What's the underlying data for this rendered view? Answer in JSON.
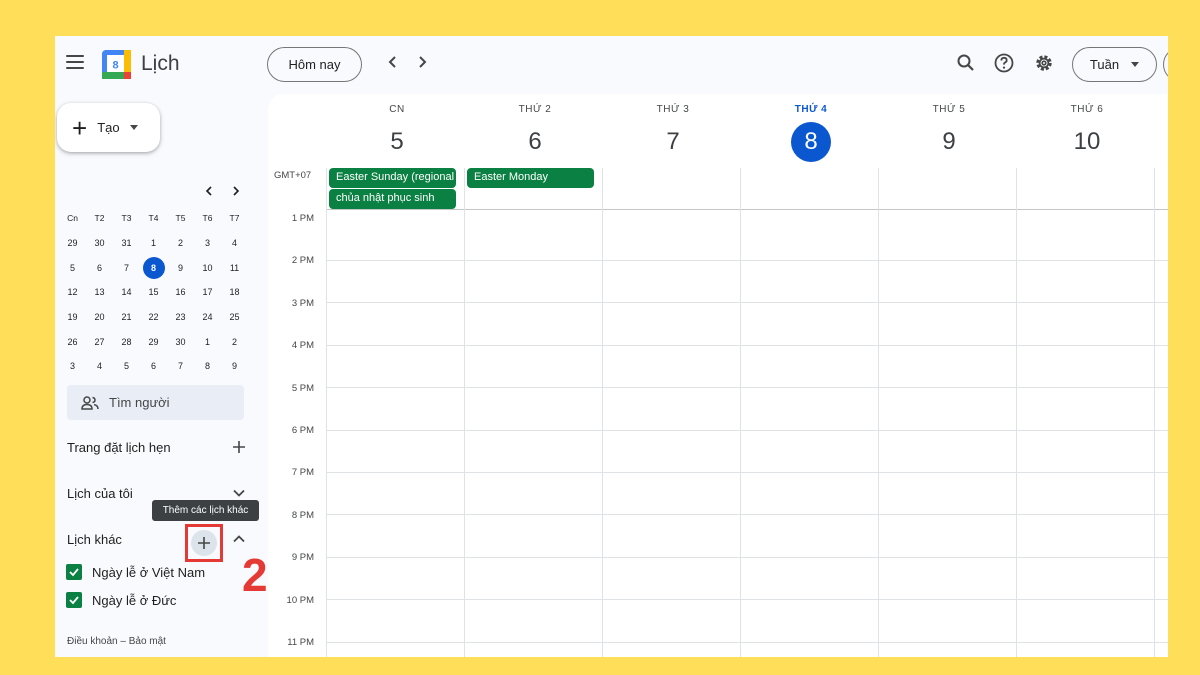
{
  "header": {
    "app_title": "Lịch",
    "logo_number": "8",
    "today_label": "Hôm nay",
    "view_label": "Tuần"
  },
  "sidebar": {
    "create_label": "Tạo",
    "mini_calendar": {
      "weekdays": [
        "Cn",
        "T2",
        "T3",
        "T4",
        "T5",
        "T6",
        "T7"
      ],
      "weeks": [
        [
          "29",
          "30",
          "31",
          "1",
          "2",
          "3",
          "4"
        ],
        [
          "5",
          "6",
          "7",
          "8",
          "9",
          "10",
          "11"
        ],
        [
          "12",
          "13",
          "14",
          "15",
          "16",
          "17",
          "18"
        ],
        [
          "19",
          "20",
          "21",
          "22",
          "23",
          "24",
          "25"
        ],
        [
          "26",
          "27",
          "28",
          "29",
          "30",
          "1",
          "2"
        ],
        [
          "3",
          "4",
          "5",
          "6",
          "7",
          "8",
          "9"
        ]
      ],
      "today": "8"
    },
    "people_search_placeholder": "Tìm người",
    "booking_pages_label": "Trang đặt lịch hẹn",
    "my_calendars_label": "Lịch của tôi",
    "other_calendars_label": "Lịch khác",
    "add_other_tooltip": "Thêm các lịch khác",
    "step_number": "2",
    "other_calendars": [
      {
        "label": "Ngày lễ ở Việt Nam",
        "color": "#0b8043"
      },
      {
        "label": "Ngày lễ ở Đức",
        "color": "#0b8043"
      }
    ],
    "footer": "Điều khoản – Bảo mật"
  },
  "week": {
    "timezone": "GMT+07",
    "days": [
      {
        "dow": "CN",
        "num": "5"
      },
      {
        "dow": "THỨ 2",
        "num": "6"
      },
      {
        "dow": "THỨ 3",
        "num": "7"
      },
      {
        "dow": "THỨ 4",
        "num": "8",
        "today": true
      },
      {
        "dow": "THỨ 5",
        "num": "9"
      },
      {
        "dow": "THỨ 6",
        "num": "10"
      }
    ],
    "hours": [
      "1 PM",
      "2 PM",
      "3 PM",
      "4 PM",
      "5 PM",
      "6 PM",
      "7 PM",
      "8 PM",
      "9 PM",
      "10 PM",
      "11 PM"
    ],
    "all_day_events": [
      {
        "day": 0,
        "title": "Easter Sunday (regional holiday)",
        "color": "#0b8043"
      },
      {
        "day": 0,
        "title": "chủa nhật phục sinh",
        "color": "#0b8043"
      },
      {
        "day": 1,
        "title": "Easter Monday",
        "color": "#0b8043"
      }
    ]
  },
  "colors": {
    "accent": "#0b57d0",
    "event_green": "#0b8043",
    "highlight_red": "#e53935",
    "background_yellow": "#ffde59"
  }
}
